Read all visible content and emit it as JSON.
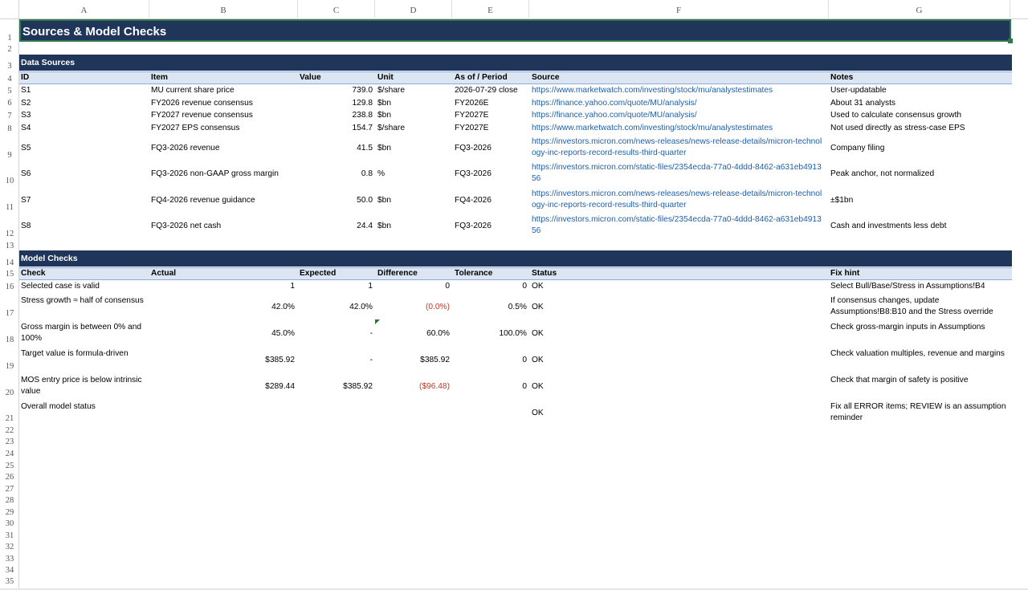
{
  "columns": [
    "A",
    "B",
    "C",
    "D",
    "E",
    "F",
    "G"
  ],
  "rows": [
    "1",
    "2",
    "3",
    "4",
    "5",
    "6",
    "7",
    "8",
    "9",
    "10",
    "11",
    "12",
    "13",
    "14",
    "15",
    "16",
    "17",
    "18",
    "19",
    "20",
    "21",
    "22",
    "23",
    "24",
    "25",
    "26",
    "27",
    "28",
    "29",
    "30",
    "31",
    "32",
    "33",
    "34",
    "35"
  ],
  "title": "Sources & Model Checks",
  "data_sources": {
    "section_title": "Data Sources",
    "headers": {
      "id": "ID",
      "item": "Item",
      "value": "Value",
      "unit": "Unit",
      "asof": "As of / Period",
      "source": "Source",
      "notes": "Notes"
    },
    "rows": [
      {
        "id": "S1",
        "item": "MU current share price",
        "value": "739.0",
        "unit": "$/share",
        "asof": "2026-07-29 close",
        "source": "https://www.marketwatch.com/investing/stock/mu/analystestimates",
        "notes": "User-updatable"
      },
      {
        "id": "S2",
        "item": "FY2026 revenue consensus",
        "value": "129.8",
        "unit": "$bn",
        "asof": "FY2026E",
        "source": "https://finance.yahoo.com/quote/MU/analysis/",
        "notes": "About 31 analysts"
      },
      {
        "id": "S3",
        "item": "FY2027 revenue consensus",
        "value": "238.8",
        "unit": "$bn",
        "asof": "FY2027E",
        "source": "https://finance.yahoo.com/quote/MU/analysis/",
        "notes": "Used to calculate consensus growth"
      },
      {
        "id": "S4",
        "item": "FY2027 EPS consensus",
        "value": "154.7",
        "unit": "$/share",
        "asof": "FY2027E",
        "source": "https://www.marketwatch.com/investing/stock/mu/analystestimates",
        "notes": "Not used directly as stress-case EPS"
      },
      {
        "id": "S5",
        "item": "FQ3-2026 revenue",
        "value": "41.5",
        "unit": "$bn",
        "asof": "FQ3-2026",
        "source": "https://investors.micron.com/news-releases/news-release-details/micron-technology-inc-reports-record-results-third-quarter",
        "notes": "Company filing"
      },
      {
        "id": "S6",
        "item": "FQ3-2026 non-GAAP gross margin",
        "value": "0.8",
        "unit": "%",
        "asof": "FQ3-2026",
        "source": "https://investors.micron.com/static-files/2354ecda-77a0-4ddd-8462-a631eb491356",
        "notes": "Peak anchor, not normalized"
      },
      {
        "id": "S7",
        "item": "FQ4-2026 revenue guidance",
        "value": "50.0",
        "unit": "$bn",
        "asof": "FQ4-2026",
        "source": "https://investors.micron.com/news-releases/news-release-details/micron-technology-inc-reports-record-results-third-quarter",
        "notes": "±$1bn"
      },
      {
        "id": "S8",
        "item": "FQ3-2026 net cash",
        "value": "24.4",
        "unit": "$bn",
        "asof": "FQ3-2026",
        "source": "https://investors.micron.com/static-files/2354ecda-77a0-4ddd-8462-a631eb491356",
        "notes": "Cash and investments less debt"
      }
    ]
  },
  "model_checks": {
    "section_title": "Model Checks",
    "headers": {
      "check": "Check",
      "actual": "Actual",
      "expected": "Expected",
      "difference": "Difference",
      "tolerance": "Tolerance",
      "status": "Status",
      "fix": "Fix hint"
    },
    "rows": [
      {
        "check": "Selected case is valid",
        "actual": "1",
        "expected": "1",
        "difference": "0",
        "tolerance": "0",
        "status": "OK",
        "fix": "Select Bull/Base/Stress in Assumptions!B4"
      },
      {
        "check": "Stress growth ≈ half of consensus",
        "actual": "42.0%",
        "expected": "42.0%",
        "difference": "(0.0%)",
        "tolerance": "0.5%",
        "status": "OK",
        "fix": "If consensus changes, update Assumptions!B8:B10 and the Stress override"
      },
      {
        "check": "Gross margin is between 0% and 100%",
        "actual": "45.0%",
        "expected": "-",
        "difference": "60.0%",
        "tolerance": "100.0%",
        "status": "OK",
        "fix": "Check gross-margin inputs in Assumptions"
      },
      {
        "check": "Target value is formula-driven",
        "actual": "$385.92",
        "expected": "-",
        "difference": "$385.92",
        "tolerance": "0",
        "status": "OK",
        "fix": "Check valuation multiples, revenue and margins"
      },
      {
        "check": "MOS entry price is below intrinsic value",
        "actual": "$289.44",
        "expected": "$385.92",
        "difference": "($96.48)",
        "tolerance": "0",
        "status": "OK",
        "fix": "Check that margin of safety is positive"
      },
      {
        "check": "Overall model status",
        "actual": "",
        "expected": "",
        "difference": "",
        "tolerance": "",
        "status": "OK",
        "fix": "Fix all ERROR items; REVIEW is an assumption reminder"
      }
    ]
  },
  "colors": {
    "header_navy": "#1f3559",
    "subheader_blue": "#dce6f2",
    "link": "#1f5fa8",
    "negative": "#c0392b",
    "selection_green": "#2f7a4a"
  }
}
